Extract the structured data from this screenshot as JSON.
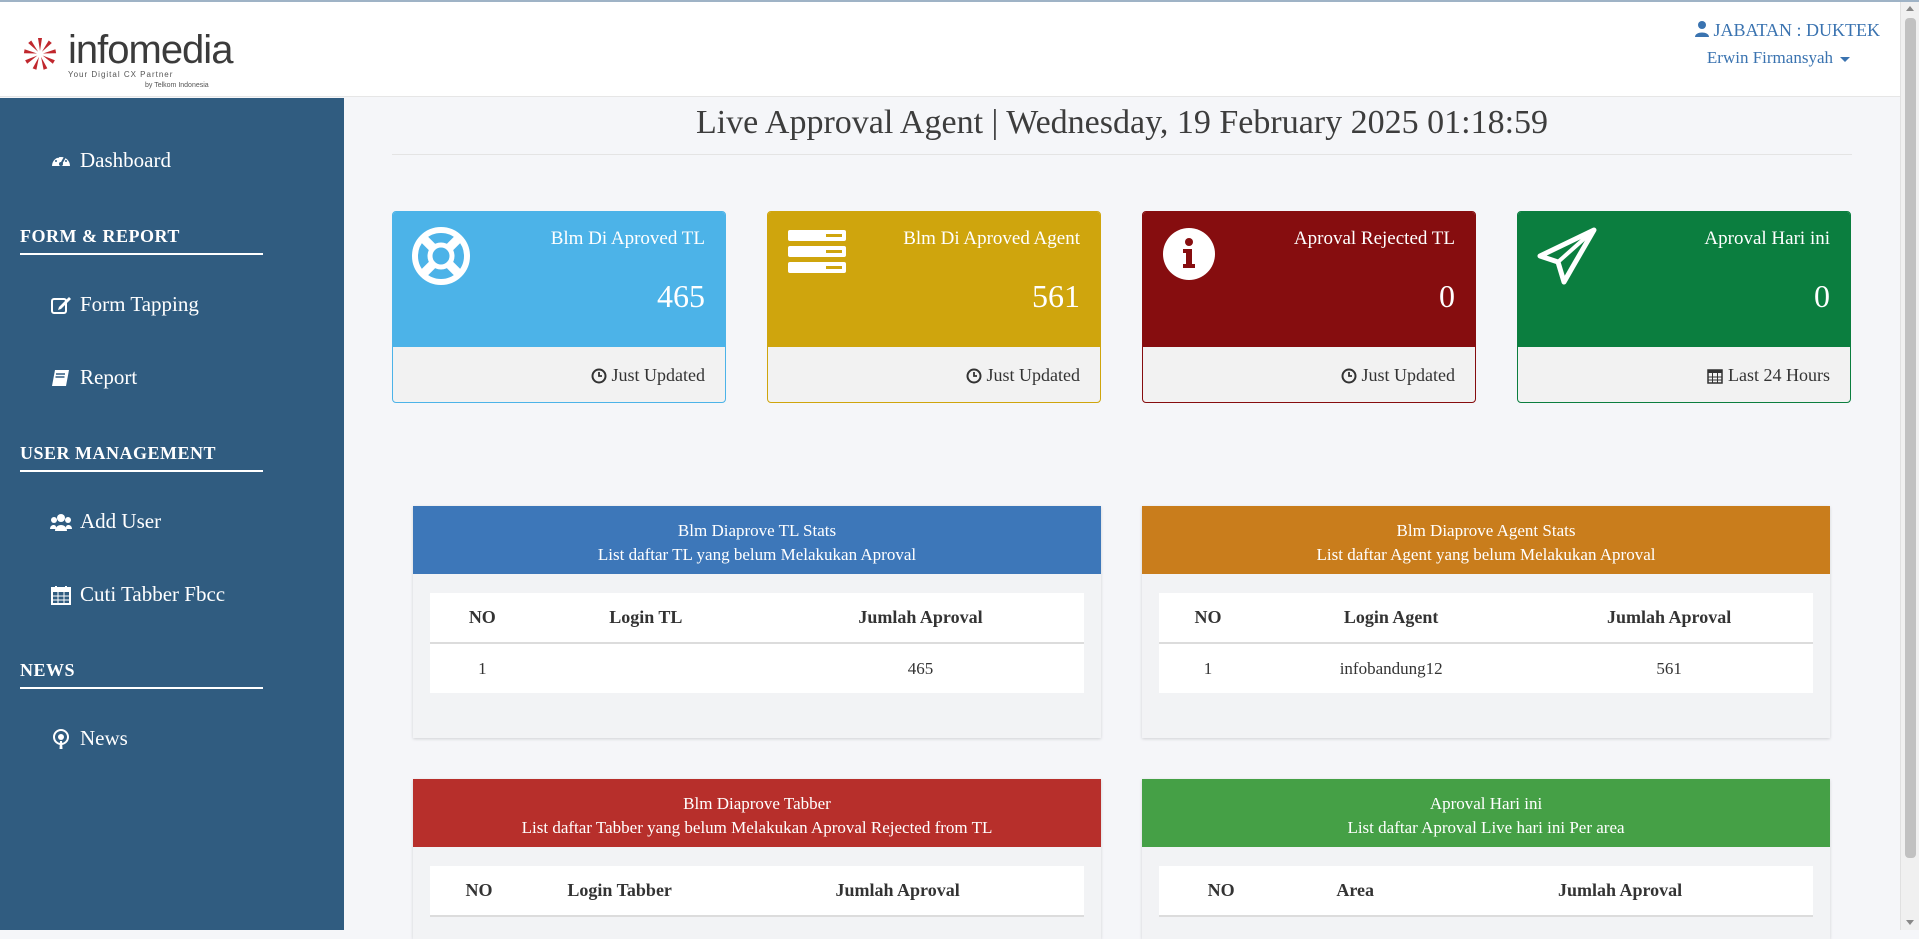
{
  "header": {
    "logo_text": "infomedia",
    "logo_tagline": "Your Digital CX Partner",
    "logo_byline": "by Telkom Indonesia",
    "jabatan": "JABATAN : DUKTEK",
    "username": "Erwin Firmansyah"
  },
  "sidebar": {
    "dashboard": "Dashboard",
    "section_form": "FORM & REPORT",
    "form_tapping": "Form Tapping",
    "report": "Report",
    "section_user": "USER MANAGEMENT",
    "add_user": "Add User",
    "cuti": "Cuti Tabber Fbcc",
    "section_news": "NEWS",
    "news": "News"
  },
  "main": {
    "title": "Live Approval Agent | Wednesday, 19 February 2025 01:18:59"
  },
  "cards": [
    {
      "title": "Blm Di Aproved TL",
      "value": "465",
      "footer": "Just Updated",
      "color": "#4cb3e8",
      "icon": "life-ring-icon"
    },
    {
      "title": "Blm Di Aproved Agent",
      "value": "561",
      "footer": "Just Updated",
      "color": "#cfa50d",
      "icon": "server-icon"
    },
    {
      "title": "Aproval Rejected TL",
      "value": "0",
      "footer": "Just Updated",
      "color": "#860d0f",
      "icon": "info-icon"
    },
    {
      "title": "Aproval Hari ini",
      "value": "0",
      "footer": "Last 24 Hours",
      "color": "#0b7e3f",
      "icon": "paper-plane-icon"
    }
  ],
  "panels": [
    {
      "heading": "Blm Diaprove TL Stats",
      "subheading": "List daftar TL yang belum Melakukan Aproval",
      "color": "#3d77b9",
      "columns": [
        "NO",
        "Login TL",
        "Jumlah Aproval"
      ],
      "rows": [
        [
          "1",
          "",
          "465"
        ]
      ]
    },
    {
      "heading": "Blm Diaprove Agent Stats",
      "subheading": "List daftar Agent yang belum Melakukan Aproval",
      "color": "#c97d1c",
      "columns": [
        "NO",
        "Login Agent",
        "Jumlah Aproval"
      ],
      "rows": [
        [
          "1",
          "infobandung12",
          "561"
        ]
      ]
    },
    {
      "heading": "Blm Diaprove Tabber",
      "subheading": "List daftar Tabber yang belum Melakukan Aproval Rejected from TL",
      "color": "#b72f2b",
      "columns": [
        "NO",
        "Login Tabber",
        "Jumlah Aproval"
      ],
      "rows": []
    },
    {
      "heading": "Aproval Hari ini",
      "subheading": "List daftar Aproval Live hari ini Per area",
      "color": "#45a046",
      "columns": [
        "NO",
        "Area",
        "Jumlah Aproval"
      ],
      "rows": []
    }
  ]
}
